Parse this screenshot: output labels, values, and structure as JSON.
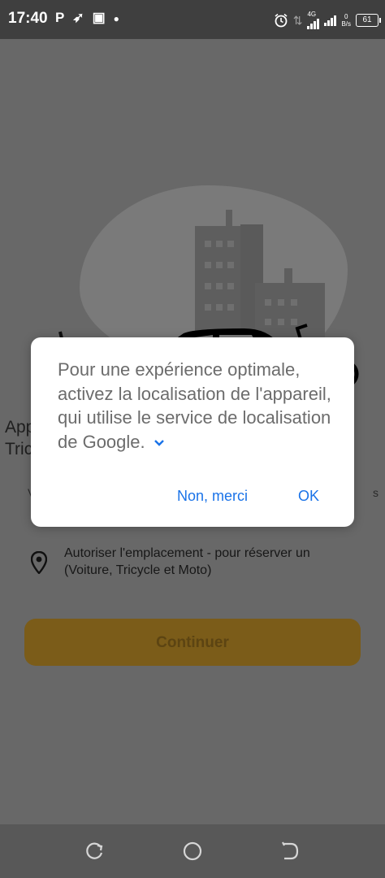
{
  "status_bar": {
    "time": "17:40",
    "left_icons": [
      "parking-icon",
      "bird-icon",
      "nfc-icon",
      "dot-icon"
    ],
    "network_label": "4G",
    "speed_value": "0",
    "speed_unit": "B/s",
    "battery": "61"
  },
  "background": {
    "title_partial": [
      "App",
      "Tric"
    ],
    "subtitle_left_partial": "V",
    "subtitle_right_partial": "s",
    "location_text": "Autoriser l'emplacement - pour réserver un (Voiture, Tricycle et Moto)",
    "continue_label": "Continuer"
  },
  "dialog": {
    "message": "Pour une expérience optimale, activez la localisation de l'appareil, qui utilise le service de localisation de Google.",
    "decline_label": "Non, merci",
    "accept_label": "OK"
  },
  "colors": {
    "accent": "#1a73e8",
    "button": "#7b5c19",
    "scrim": "#686868"
  }
}
